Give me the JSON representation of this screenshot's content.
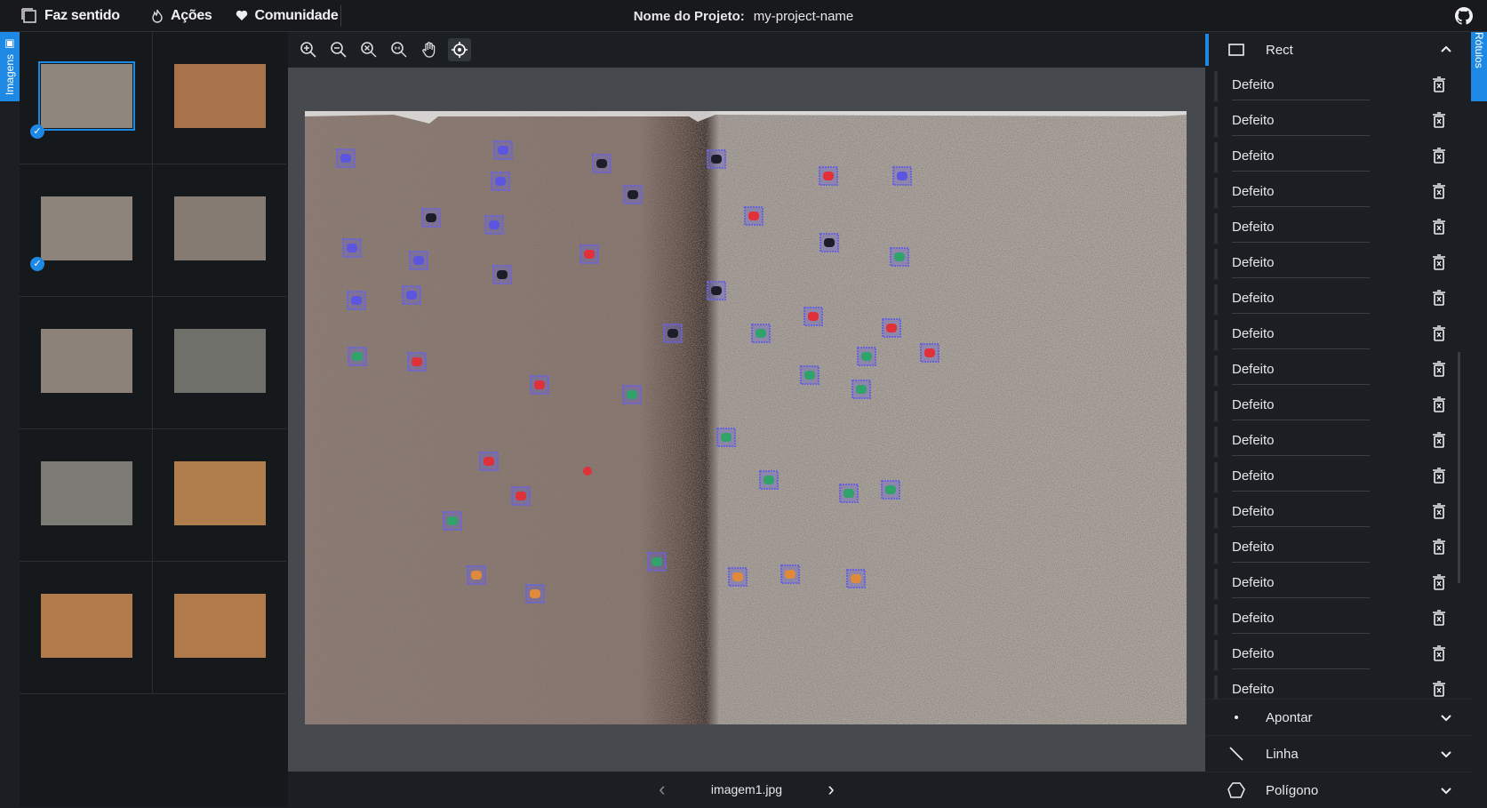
{
  "topbar": {
    "menu": [
      {
        "label": "Faz sentido",
        "icon": "logo-frame-icon"
      },
      {
        "label": "Ações",
        "icon": "fire-icon"
      },
      {
        "label": "Comunidade",
        "icon": "heart-icon"
      }
    ],
    "project_label": "Nome do Projeto:",
    "project_name": "my-project-name",
    "github_icon": "github-icon"
  },
  "side_tabs": {
    "left": "Imagens",
    "right": "Rótulos"
  },
  "thumbnails": [
    {
      "color": "#8f877e",
      "selected": true,
      "checked": true
    },
    {
      "color": "#a8724a",
      "selected": false,
      "checked": false
    },
    {
      "color": "#8c847a",
      "selected": false,
      "checked": true
    },
    {
      "color": "#857b73",
      "selected": false,
      "checked": false
    },
    {
      "color": "#8d8279",
      "selected": false,
      "checked": false
    },
    {
      "color": "#70706a",
      "selected": false,
      "checked": false
    },
    {
      "color": "#7c7a74",
      "selected": false,
      "checked": false
    },
    {
      "color": "#b07d4c",
      "selected": false,
      "checked": false
    },
    {
      "color": "#b27b4c",
      "selected": false,
      "checked": false
    },
    {
      "color": "#b07a4a",
      "selected": false,
      "checked": false
    }
  ],
  "toolbar": [
    "zoom-in-icon",
    "zoom-out-icon",
    "zoom-reset-icon",
    "zoom-fit-icon",
    "pan-hand-icon",
    "focus-target-icon"
  ],
  "image_name": "imagem1.jpg",
  "right_panel": {
    "active_tool": "Rect",
    "labels": [
      "Defeito",
      "Defeito",
      "Defeito",
      "Defeito",
      "Defeito",
      "Defeito",
      "Defeito",
      "Defeito",
      "Defeito",
      "Defeito",
      "Defeito",
      "Defeito",
      "Defeito",
      "Defeito",
      "Defeito",
      "Defeito",
      "Defeito",
      "Defeito"
    ],
    "other_tools": [
      "Apontar",
      "Linha",
      "Polígono"
    ]
  },
  "colors": {
    "accent": "#1e88e5",
    "box": "#6a64d8",
    "red": "#e0303a",
    "green": "#2fa36a",
    "blue": "#5b55e0",
    "orange": "#e08a3c",
    "dark": "#1d1d2a"
  }
}
